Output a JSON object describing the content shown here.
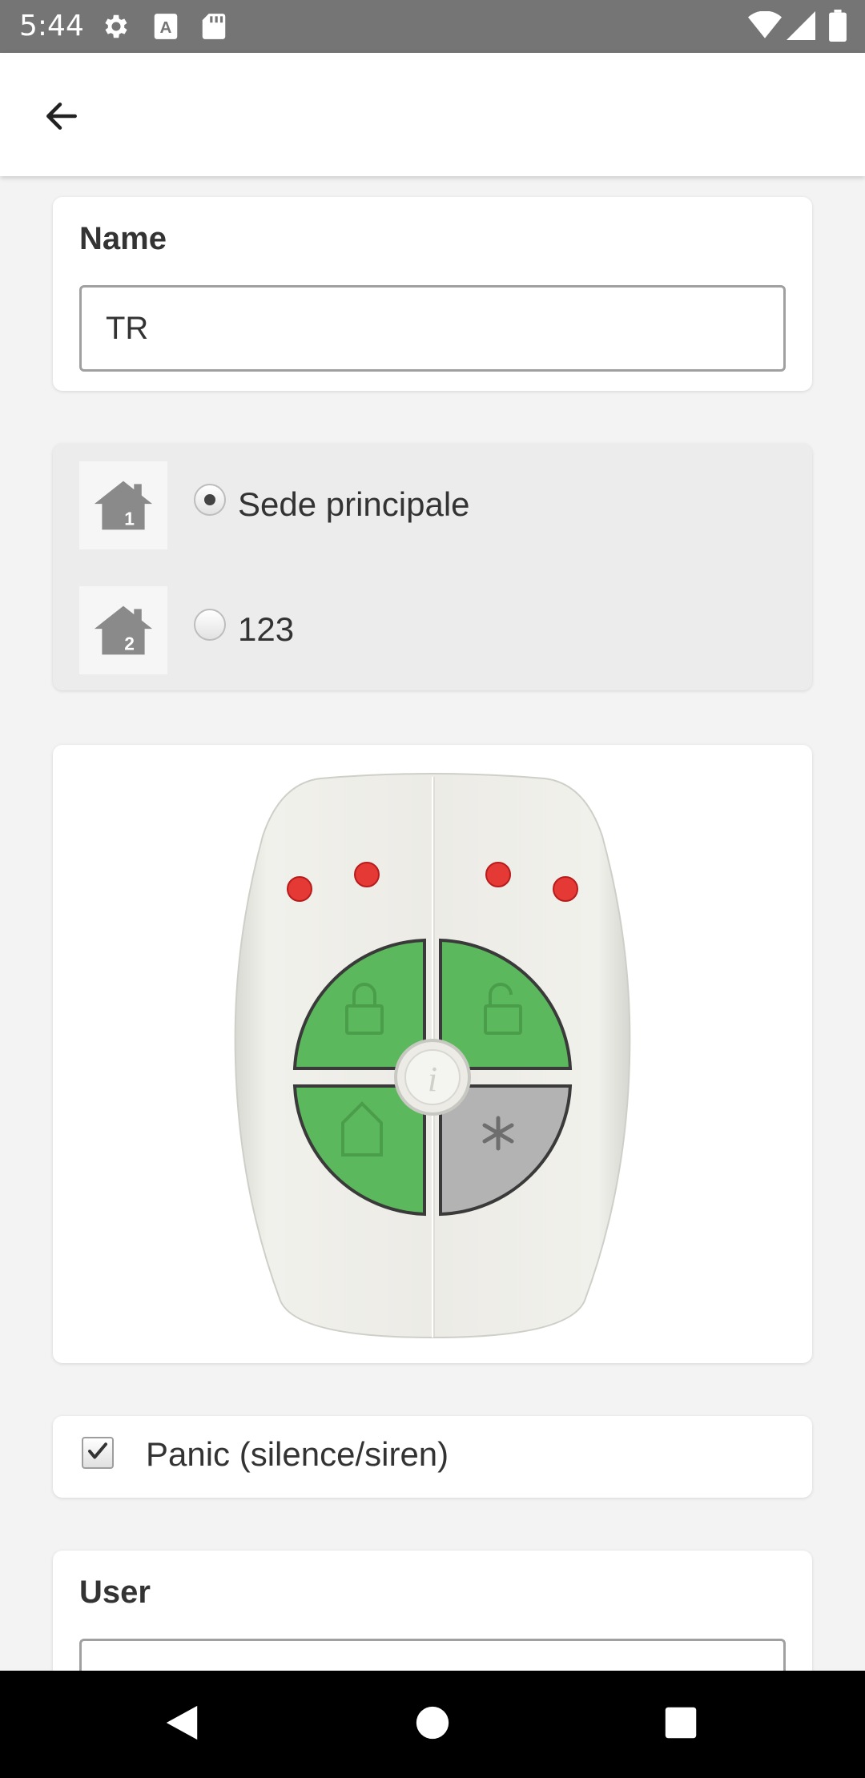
{
  "status_bar": {
    "time": "5:44",
    "icons": [
      "gear-icon",
      "font-a-icon",
      "sd-card-icon",
      "wifi-icon",
      "signal-icon",
      "battery-icon"
    ]
  },
  "app_bar": {
    "back_icon": "arrow-back-icon"
  },
  "name_card": {
    "label": "Name",
    "value": "TR"
  },
  "locations": [
    {
      "label": "Sede principale",
      "icon": "house-1-icon",
      "selected": true
    },
    {
      "label": "123",
      "icon": "house-2-icon",
      "selected": false
    }
  ],
  "remote": {
    "image": "keyfob-remote",
    "buttons": [
      "lock-button",
      "unlock-button",
      "home-button",
      "star-button"
    ],
    "colors": {
      "green": "#5cb85c",
      "gray": "#b3b3b3",
      "led": "#e53935"
    }
  },
  "panic": {
    "label": "Panic (silence/siren)",
    "checked": true
  },
  "user_card": {
    "label": "User"
  },
  "nav_bar": {
    "buttons": [
      "back-triangle-icon",
      "home-circle-icon",
      "recents-square-icon"
    ]
  }
}
